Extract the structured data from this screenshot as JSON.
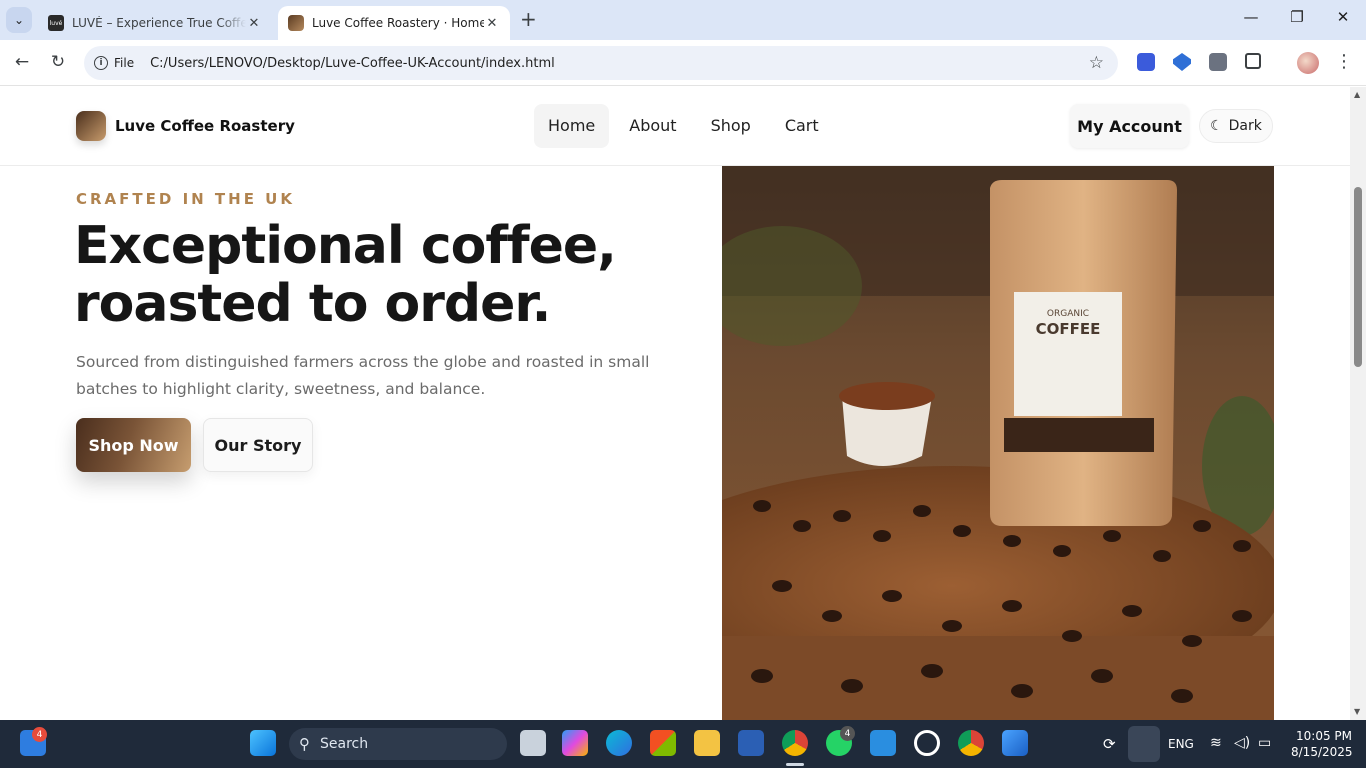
{
  "browser": {
    "tabs": [
      {
        "title": "LUVÉ – Experience True Coffee E",
        "active": false,
        "favicon_text": "luvé"
      },
      {
        "title": "Luve Coffee Roastery · Home",
        "active": true
      }
    ],
    "address": {
      "scheme": "File",
      "url": "C:/Users/LENOVO/Desktop/Luve-Coffee-UK-Account/index.html"
    }
  },
  "site": {
    "brand": "Luve Coffee Roastery",
    "nav": [
      "Home",
      "About",
      "Shop",
      "Cart"
    ],
    "account_label": "My Account",
    "theme_label": "Dark",
    "theme_icon": "moon-icon"
  },
  "hero": {
    "kicker": "CRAFTED IN THE UK",
    "title": "Exceptional coffee, roasted to order.",
    "subtitle": "Sourced from distinguished farmers across the globe and roasted in small batches to highlight clarity, sweetness, and balance.",
    "primary_button": "Shop Now",
    "secondary_button": "Our Story",
    "image": {
      "bag_label_top": "ORGANIC",
      "bag_label_main": "COFFEE"
    }
  },
  "taskbar": {
    "search_label": "Search",
    "widget_badge": "4",
    "whatsapp_badge": "4",
    "language": "ENG",
    "time": "10:05 PM",
    "date": "8/15/2025"
  },
  "colors": {
    "accent": "#b0834f",
    "brand_dark": "#4a2e1d",
    "taskbar": "#1f2a3a"
  }
}
